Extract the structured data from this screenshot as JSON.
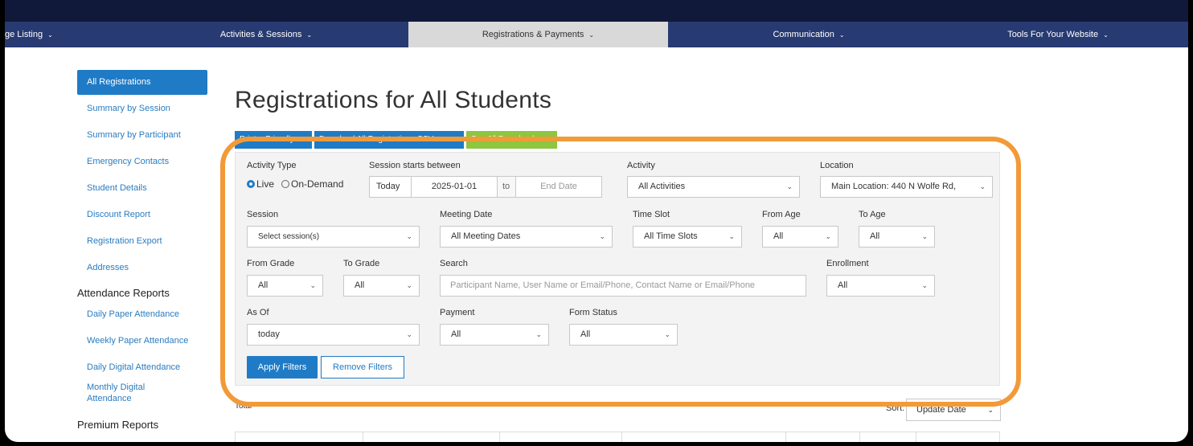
{
  "nav": {
    "items": [
      {
        "label": "ge Listing",
        "active": false
      },
      {
        "label": "Activities & Sessions",
        "active": false
      },
      {
        "label": "Registrations & Payments",
        "active": true
      },
      {
        "label": "Communication",
        "active": false
      },
      {
        "label": "Tools For Your Website",
        "active": false
      }
    ],
    "chevron": "⌄"
  },
  "sidebar": {
    "items": [
      {
        "label": "All Registrations"
      },
      {
        "label": "Summary by Session"
      },
      {
        "label": "Summary by Participant"
      },
      {
        "label": "Emergency Contacts"
      },
      {
        "label": "Student Details"
      },
      {
        "label": "Discount Report"
      },
      {
        "label": "Registration Export"
      },
      {
        "label": "Addresses"
      }
    ],
    "attendance_heading": "Attendance Reports",
    "attendance_items": [
      {
        "label": "Daily Paper Attendance"
      },
      {
        "label": "Weekly Paper Attendance"
      },
      {
        "label": "Daily Digital Attendance"
      },
      {
        "label": "Monthly Digital Attendance"
      }
    ],
    "premium_heading": "Premium Reports"
  },
  "page": {
    "title": "Registrations for All Students",
    "buttons": [
      {
        "label": "Printer Friendly",
        "color": "#1f7bc6"
      },
      {
        "label": "Download All Registrations CSV",
        "color": "#1f7bc6"
      },
      {
        "label": "See All Download",
        "color": "#8dc63f"
      }
    ]
  },
  "filters": {
    "activity_type": {
      "label": "Activity Type",
      "options": [
        "Live",
        "On-Demand"
      ],
      "selected": "Live"
    },
    "session_between": {
      "label": "Session starts between",
      "start_prefix": "Today",
      "start": "2025-01-01",
      "to": "to",
      "end_placeholder": "End Date"
    },
    "activity": {
      "label": "Activity",
      "value": "All Activities"
    },
    "location": {
      "label": "Location",
      "value": "Main Location: 440 N Wolfe Rd,"
    },
    "session": {
      "label": "Session",
      "value": "Select session(s)"
    },
    "meeting_date": {
      "label": "Meeting Date",
      "value": "All Meeting Dates"
    },
    "time_slot": {
      "label": "Time Slot",
      "value": "All Time Slots"
    },
    "from_age": {
      "label": "From Age",
      "value": "All"
    },
    "to_age": {
      "label": "To Age",
      "value": "All"
    },
    "from_grade": {
      "label": "From Grade",
      "value": "All"
    },
    "to_grade": {
      "label": "To Grade",
      "value": "All"
    },
    "search": {
      "label": "Search",
      "placeholder": "Participant Name, User Name or Email/Phone, Contact Name or Email/Phone"
    },
    "enrollment": {
      "label": "Enrollment",
      "value": "All"
    },
    "as_of": {
      "label": "As Of",
      "value": "today"
    },
    "payment": {
      "label": "Payment",
      "value": "All"
    },
    "form_status": {
      "label": "Form Status",
      "value": "All"
    },
    "apply": "Apply Filters",
    "remove": "Remove Filters"
  },
  "results": {
    "total_label": "Total",
    "sort_label": "Sort:",
    "sort_value": "Update Date"
  },
  "colors": {
    "accent": "#1f7bc6",
    "highlight": "#f29a38",
    "nav": "#283a72"
  }
}
